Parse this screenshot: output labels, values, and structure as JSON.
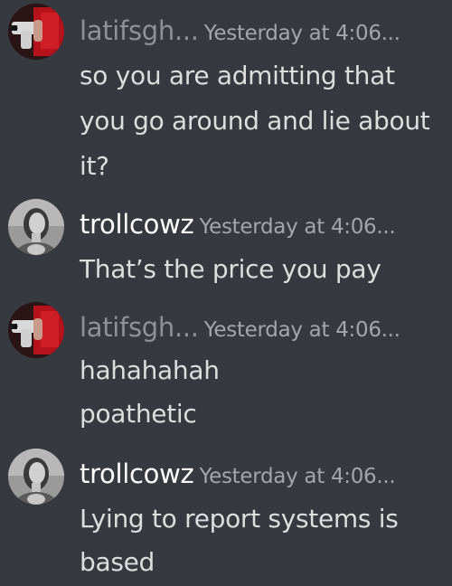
{
  "messages": [
    {
      "author": "latifsgh...",
      "timestamp": "Yesterday at 4:06...",
      "avatar": "gun-pointing-avatar",
      "lines": [
        "so you are admitting that",
        "you go around and lie about",
        "it?"
      ]
    },
    {
      "author": "trollcowz",
      "timestamp": "Yesterday at 4:06...",
      "avatar": "woman-portrait-avatar",
      "lines": [
        "That’s the price you pay"
      ]
    },
    {
      "author": "latifsgh...",
      "timestamp": "Yesterday at 4:06...",
      "avatar": "gun-pointing-avatar",
      "lines": [
        "hahahahah",
        "poathetic"
      ]
    },
    {
      "author": "trollcowz",
      "timestamp": "Yesterday at 4:06...",
      "avatar": "woman-portrait-avatar",
      "lines": [
        "Lying to report systems is",
        "based"
      ]
    }
  ],
  "colors": {
    "background": "#36393f",
    "text": "#dcddde",
    "timestamp": "#a3a6aa",
    "username_muted": "#8e9297",
    "username_bright": "#ffffff"
  }
}
